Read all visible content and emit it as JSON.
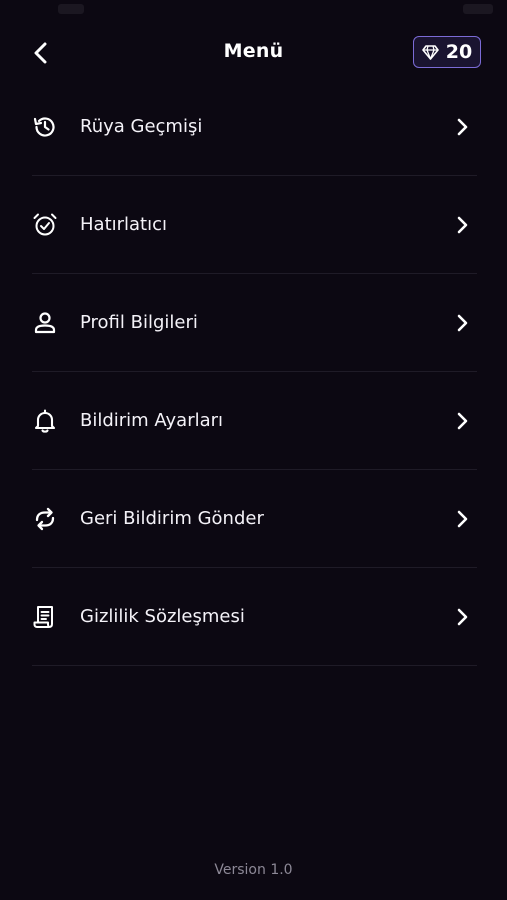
{
  "header": {
    "title": "Menü",
    "gem_count": "20"
  },
  "menu": {
    "items": [
      {
        "label": "Rüya Geçmişi",
        "icon": "history-icon"
      },
      {
        "label": "Hatırlatıcı",
        "icon": "alarm-clock-icon"
      },
      {
        "label": "Profil Bilgileri",
        "icon": "user-icon"
      },
      {
        "label": "Bildirim Ayarları",
        "icon": "bell-icon"
      },
      {
        "label": "Geri Bildirim Gönder",
        "icon": "feedback-icon"
      },
      {
        "label": "Gizlilik Sözleşmesi",
        "icon": "document-icon"
      }
    ]
  },
  "footer": {
    "version": "Version 1.0"
  },
  "colors": {
    "background": "#0c0812",
    "accent_border": "#7b6bd6",
    "divider": "#1f1b27",
    "muted_text": "#8c8896"
  }
}
